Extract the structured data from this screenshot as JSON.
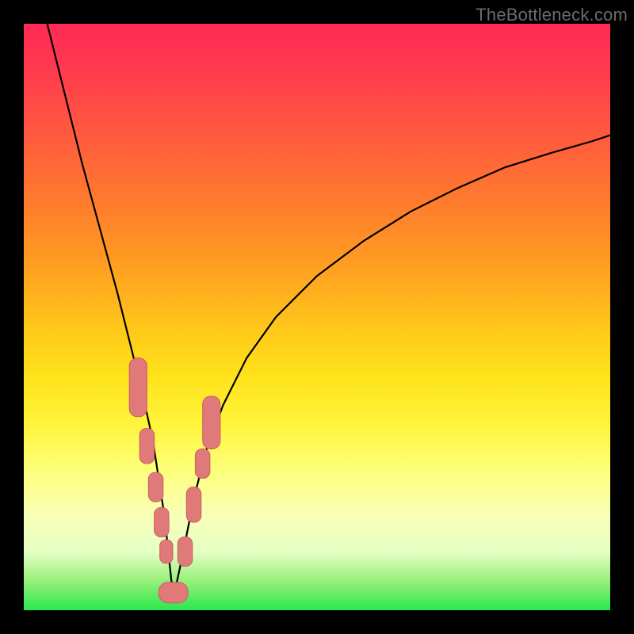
{
  "watermark": {
    "text": "TheBottleneck.com"
  },
  "colors": {
    "frame": "#000000",
    "curve": "#000000",
    "marker_fill": "#e07a7a",
    "marker_stroke": "#c95f5f",
    "gradient_stops": [
      "#ff2a55",
      "#ff3b4e",
      "#ff5740",
      "#ff7a2e",
      "#ff9a22",
      "#ffc71a",
      "#ffe21a",
      "#fff43a",
      "#fdff7a",
      "#f8ffb8",
      "#e6ffc4",
      "#97f07a",
      "#29e84c"
    ]
  },
  "chart_data": {
    "type": "line",
    "title": "",
    "xlabel": "",
    "ylabel": "",
    "xlim": [
      0,
      100
    ],
    "ylim": [
      0,
      100
    ],
    "notes": "Axes carry no tick labels; values below are read from the plotting coordinate frame (0–100 on each axis, y=0 at bottom). The curve is V-shaped with its minimum near x≈25, y≈0. The right arm asymptotically approaches ~80% height. Markers (salmon rounded-rect pills) cluster on both arms near the valley.",
    "series": [
      {
        "name": "curve",
        "x": [
          4,
          7,
          10,
          13,
          16,
          18,
          20,
          22,
          24,
          25.5,
          27,
          29,
          31,
          34,
          38,
          43,
          50,
          58,
          66,
          74,
          82,
          90,
          97,
          100
        ],
        "y": [
          100,
          88,
          76,
          65,
          54,
          46,
          38,
          29,
          16,
          2,
          9,
          19,
          27,
          35,
          43,
          50,
          57,
          63,
          68,
          72,
          75.5,
          78,
          80,
          81
        ]
      }
    ],
    "markers": [
      {
        "name": "left-cluster-top",
        "x": 19.5,
        "y": 38,
        "w": 3.0,
        "h": 10
      },
      {
        "name": "left-cluster-upper",
        "x": 21.0,
        "y": 28,
        "w": 2.5,
        "h": 6
      },
      {
        "name": "left-cluster-mid",
        "x": 22.5,
        "y": 21,
        "w": 2.5,
        "h": 5
      },
      {
        "name": "left-cluster-low1",
        "x": 23.5,
        "y": 15,
        "w": 2.5,
        "h": 5
      },
      {
        "name": "left-cluster-low2",
        "x": 24.3,
        "y": 10,
        "w": 2.2,
        "h": 4
      },
      {
        "name": "valley-pill",
        "x": 25.5,
        "y": 3,
        "w": 5.0,
        "h": 3.5
      },
      {
        "name": "right-cluster-low",
        "x": 27.5,
        "y": 10,
        "w": 2.5,
        "h": 5
      },
      {
        "name": "right-cluster-mid1",
        "x": 29.0,
        "y": 18,
        "w": 2.5,
        "h": 6
      },
      {
        "name": "right-cluster-mid2",
        "x": 30.5,
        "y": 25,
        "w": 2.5,
        "h": 5
      },
      {
        "name": "right-cluster-top",
        "x": 32.0,
        "y": 32,
        "w": 3.0,
        "h": 9
      }
    ]
  }
}
